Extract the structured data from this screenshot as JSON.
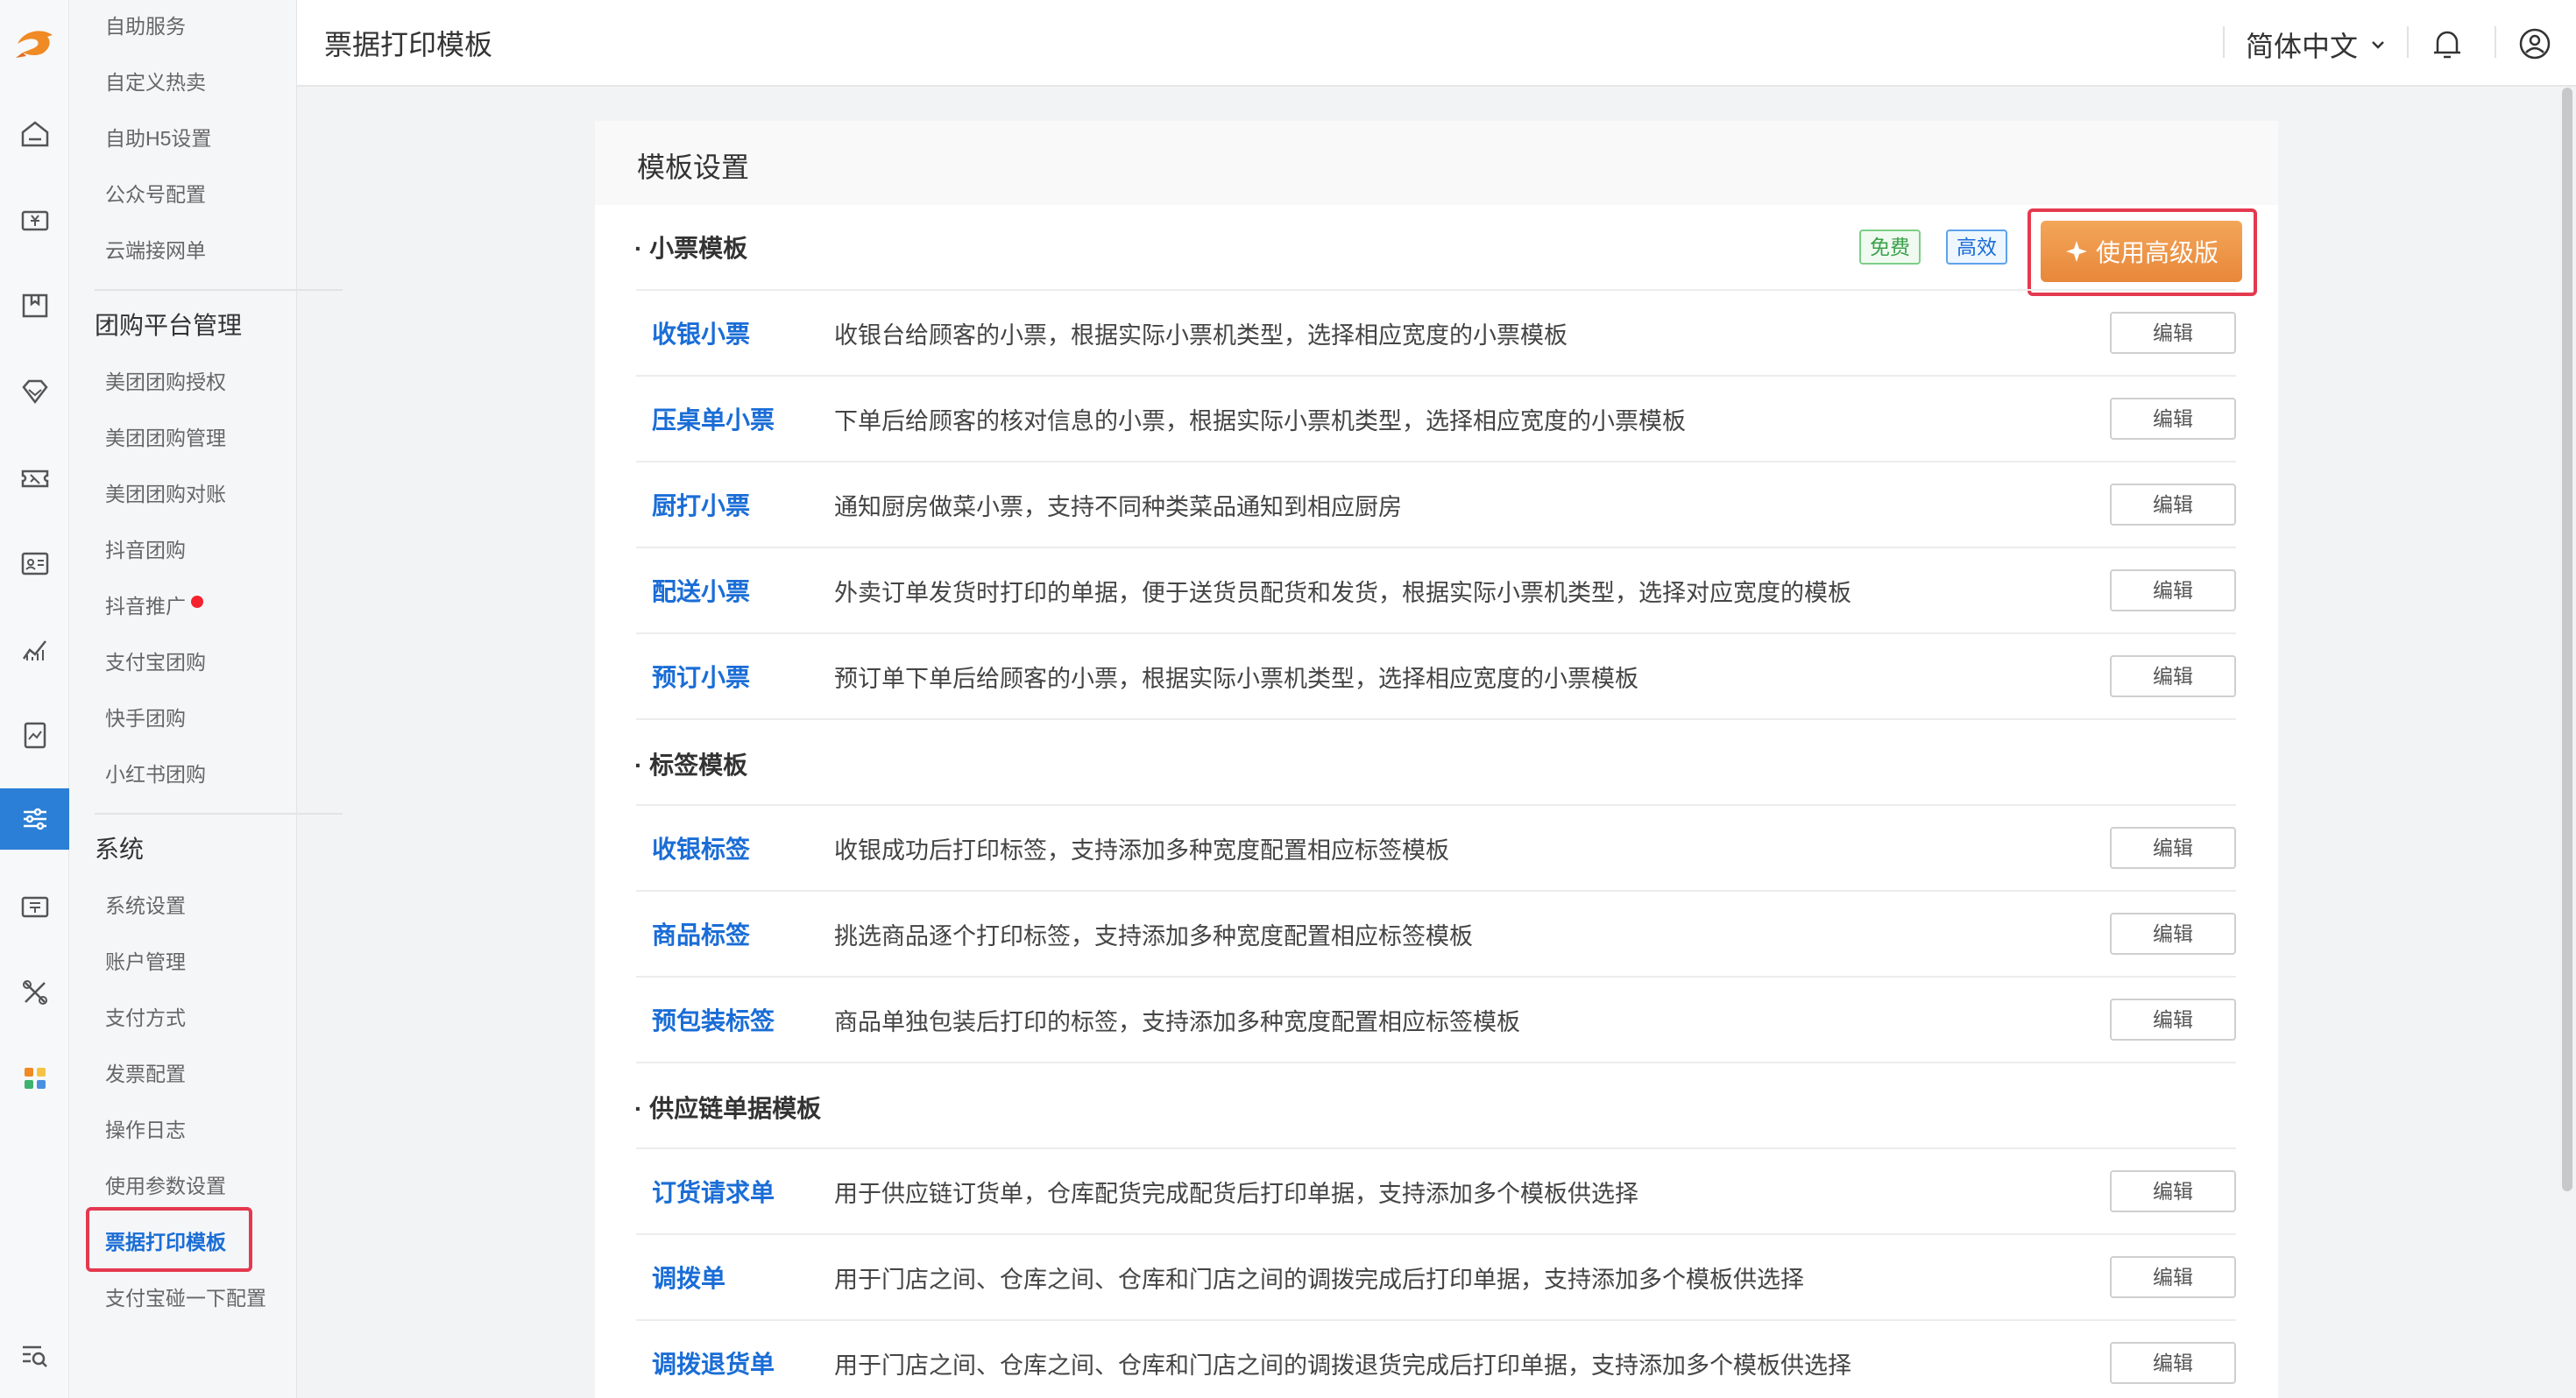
{
  "header": {
    "title": "票据打印模板",
    "language": "简体中文"
  },
  "rail": {
    "icons": [
      "logo-icon",
      "home-icon",
      "cashier-icon",
      "inventory-icon",
      "member-diamond-icon",
      "coupon-icon",
      "employee-card-icon",
      "analytics-icon",
      "report-icon",
      "settings-sliders-icon",
      "voucher-icon",
      "tools-icon",
      "apps-grid-icon",
      "search-list-icon"
    ],
    "active": "settings-sliders-icon",
    "accent_color": "#2b7fd6"
  },
  "submenu": {
    "top_items": [
      "自助服务",
      "自定义热卖",
      "自助H5设置",
      "公众号配置",
      "云端接网单"
    ],
    "groups": [
      {
        "title": "团购平台管理",
        "items": [
          "美团团购授权",
          "美团团购管理",
          "美团团购对账",
          "抖音团购",
          "抖音推广",
          "支付宝团购",
          "快手团购",
          "小红书团购"
        ]
      },
      {
        "title": "系统",
        "items": [
          "系统设置",
          "账户管理",
          "支付方式",
          "发票配置",
          "操作日志",
          "使用参数设置",
          "票据打印模板",
          "支付宝碰一下配置"
        ]
      }
    ]
  },
  "card": {
    "title": "模板设置",
    "badges": {
      "free": "免费",
      "efficient": "高效"
    },
    "advanced_button": "使用高级版",
    "edit_label": "编辑",
    "sections": [
      {
        "title": "小票模板",
        "rows": [
          {
            "name": "收银小票",
            "desc": "收银台给顾客的小票，根据实际小票机类型，选择相应宽度的小票模板"
          },
          {
            "name": "压桌单小票",
            "desc": "下单后给顾客的核对信息的小票，根据实际小票机类型，选择相应宽度的小票模板"
          },
          {
            "name": "厨打小票",
            "desc": "通知厨房做菜小票，支持不同种类菜品通知到相应厨房"
          },
          {
            "name": "配送小票",
            "desc": "外卖订单发货时打印的单据，便于送货员配货和发货，根据实际小票机类型，选择对应宽度的模板"
          },
          {
            "name": "预订小票",
            "desc": "预订单下单后给顾客的小票，根据实际小票机类型，选择相应宽度的小票模板"
          }
        ]
      },
      {
        "title": "标签模板",
        "rows": [
          {
            "name": "收银标签",
            "desc": "收银成功后打印标签，支持添加多种宽度配置相应标签模板"
          },
          {
            "name": "商品标签",
            "desc": "挑选商品逐个打印标签，支持添加多种宽度配置相应标签模板"
          },
          {
            "name": "预包装标签",
            "desc": "商品单独包装后打印的标签，支持添加多种宽度配置相应标签模板"
          }
        ]
      },
      {
        "title": "供应链单据模板",
        "rows": [
          {
            "name": "订货请求单",
            "desc": "用于供应链订货单，仓库配货完成配货后打印单据，支持添加多个模板供选择"
          },
          {
            "name": "调拨单",
            "desc": "用于门店之间、仓库之间、仓库和门店之间的调拨完成后打印单据，支持添加多个模板供选择"
          },
          {
            "name": "调拨退货单",
            "desc": "用于门店之间、仓库之间、仓库和门店之间的调拨退货完成后打印单据，支持添加多个模板供选择"
          }
        ]
      }
    ]
  }
}
